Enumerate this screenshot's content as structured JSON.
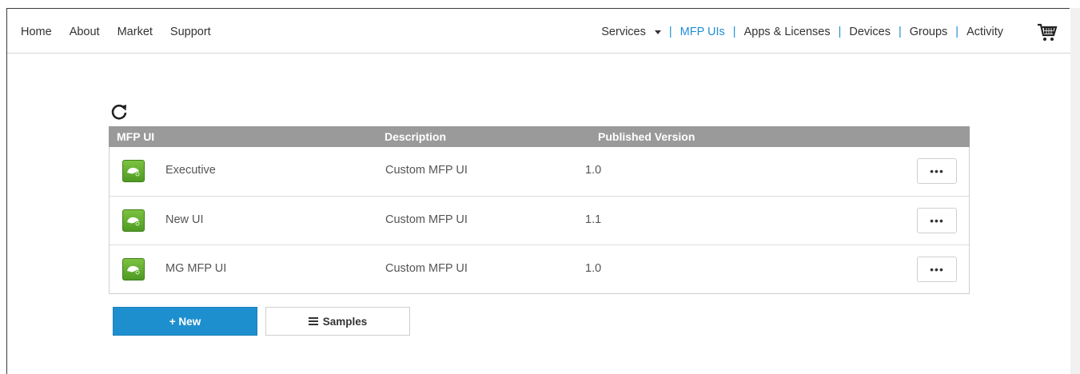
{
  "nav_left": [
    "Home",
    "About",
    "Market",
    "Support"
  ],
  "nav_right": {
    "services": "Services",
    "sep": "|",
    "items": [
      "MFP UIs",
      "Apps & Licenses",
      "Devices",
      "Groups",
      "Activity"
    ],
    "active": "MFP UIs"
  },
  "table": {
    "headers": [
      "MFP UI",
      "Description",
      "Published Version"
    ],
    "rows": [
      {
        "name": "Executive",
        "description": "Custom MFP UI",
        "version": "1.0",
        "more": "•••"
      },
      {
        "name": "New UI",
        "description": "Custom MFP UI",
        "version": "1.1",
        "more": "•••"
      },
      {
        "name": "MG MFP UI",
        "description": "Custom MFP UI",
        "version": "1.0",
        "more": "•••"
      }
    ]
  },
  "buttons": {
    "new": "+ New",
    "samples": "Samples"
  },
  "colors": {
    "accent": "#1e8fce",
    "active_link": "#1f8dd6",
    "header_bg": "#9a9a9a",
    "app_icon": "#5ea82e"
  },
  "icons": {
    "refresh": "refresh-icon",
    "cart": "shopping-cart-icon",
    "app": "chameleon-icon",
    "samples": "list-icon"
  }
}
